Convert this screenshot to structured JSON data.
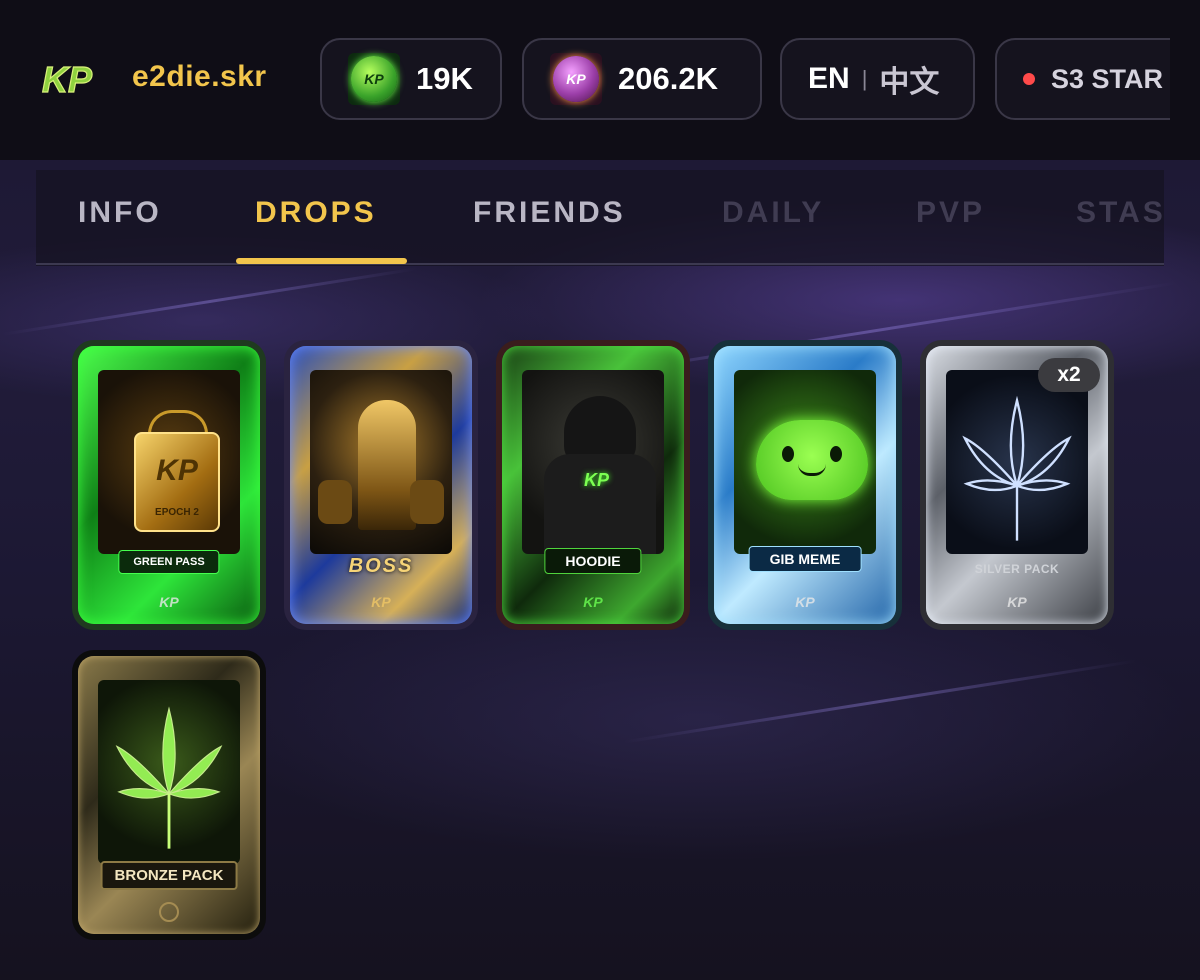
{
  "header": {
    "logo_text": "KP",
    "username": "e2die.skr",
    "balances": [
      {
        "icon": "green-token-icon",
        "value": "19K"
      },
      {
        "icon": "purple-token-icon",
        "value": "206.2K"
      }
    ],
    "language": {
      "active": "EN",
      "separator": "|",
      "other": "中文"
    },
    "season_status": "S3 STAR"
  },
  "tabs": [
    {
      "label": "INFO",
      "state": "normal"
    },
    {
      "label": "DROPS",
      "state": "active"
    },
    {
      "label": "FRIENDS",
      "state": "normal"
    },
    {
      "label": "DAILY",
      "state": "disabled"
    },
    {
      "label": "PVP",
      "state": "disabled"
    },
    {
      "label": "STAS",
      "state": "disabled"
    }
  ],
  "colors": {
    "accent_gold": "#f2c54c",
    "tab_normal": "#b9b6c4",
    "tab_disabled": "#403c52"
  },
  "drops": [
    {
      "label": "GREEN PASS",
      "art_text": "EPOCH 2",
      "frame": "green",
      "quantity": null
    },
    {
      "label": "BOSS",
      "frame": "blue-gold",
      "quantity": null
    },
    {
      "label": "HOODIE",
      "frame": "green-dark",
      "quantity": null
    },
    {
      "label": "GIB MEME",
      "frame": "ice-blue",
      "quantity": null
    },
    {
      "label": "SILVER PACK",
      "frame": "silver",
      "quantity": "x2"
    },
    {
      "label": "BRONZE PACK",
      "frame": "bronze",
      "quantity": null
    }
  ]
}
